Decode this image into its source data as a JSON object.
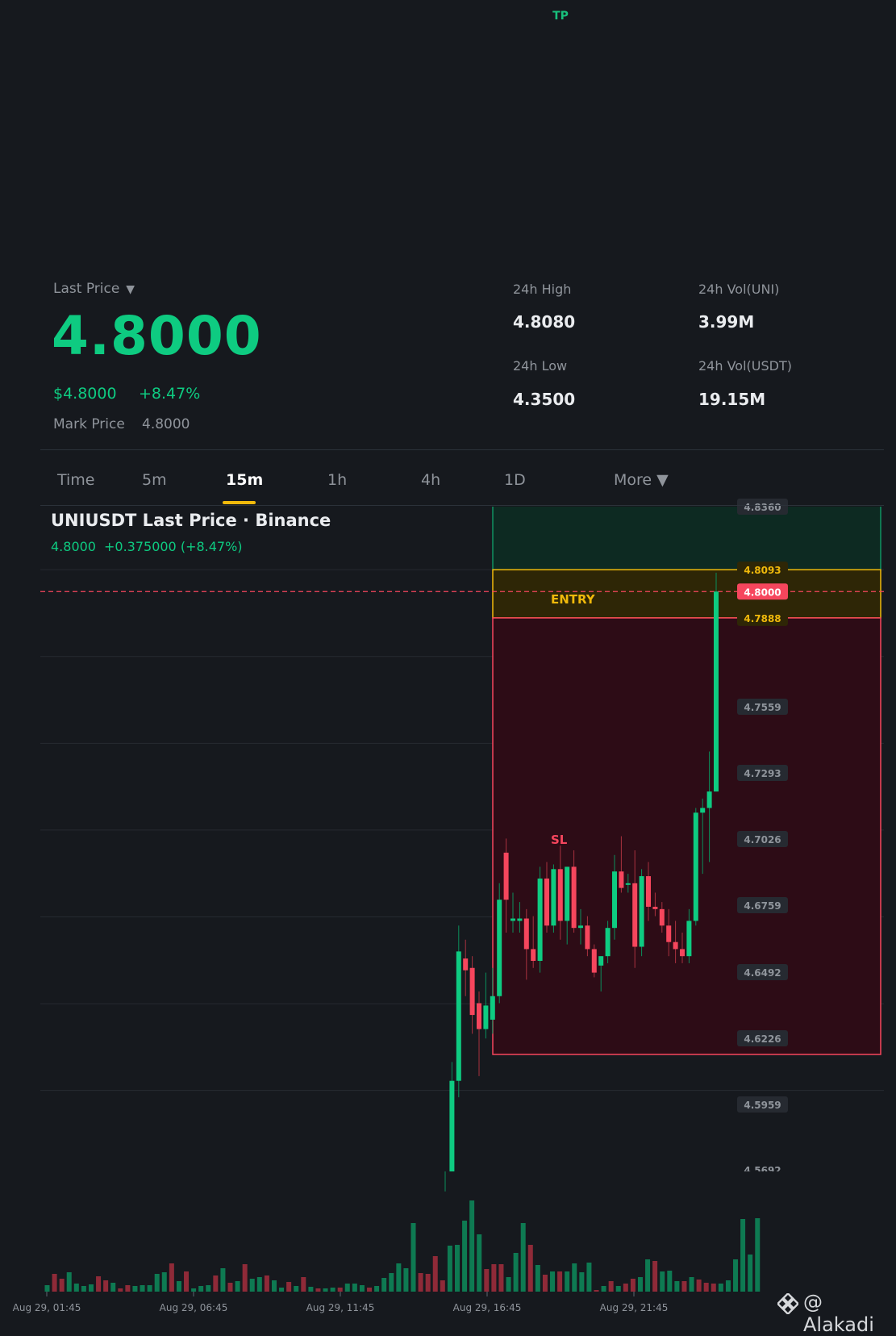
{
  "overlay": {
    "tp_label": "TP",
    "entry_label": "ENTRY",
    "sl_label": "SL"
  },
  "ticker": {
    "last_price_label": "Last Price",
    "last_price": "4.8000",
    "usd_price": "$4.8000",
    "change_pct": "+8.47%",
    "mark_price_label": "Mark Price",
    "mark_price": "4.8000",
    "stats": [
      {
        "label": "24h High",
        "value": "4.8080"
      },
      {
        "label": "24h Vol(UNI)",
        "value": "3.99M"
      },
      {
        "label": "24h Low",
        "value": "4.3500"
      },
      {
        "label": "24h Vol(USDT)",
        "value": "19.15M"
      }
    ]
  },
  "tabs": {
    "time": "Time",
    "m5": "5m",
    "m15": "15m",
    "h1": "1h",
    "h4": "4h",
    "d1": "1D",
    "more": "More"
  },
  "chart_header": {
    "title": "UNIUSDT Last Price · Binance",
    "price": "4.8000",
    "change": "+0.375000 (+8.47%)"
  },
  "watermark": "@ Alakadi",
  "colors": {
    "up": "#0ecb81",
    "down": "#f6465d",
    "accent": "#f0b90b",
    "background": "#16191e"
  },
  "chart_data": {
    "type": "candlestick",
    "y_ticks": [
      "4.8360",
      "4.5692",
      "4.5959",
      "4.6226",
      "4.6492",
      "4.6759",
      "4.7026",
      "4.7293",
      "4.7559"
    ],
    "levels": {
      "tp_top": "4.8093",
      "last": "4.8000",
      "entry_bottom": "4.7888"
    },
    "x_ticks": [
      "Aug 29, 01:45",
      "Aug 29, 06:45",
      "Aug 29, 11:45",
      "Aug 29, 16:45",
      "Aug 29, 21:45"
    ],
    "ylim": [
      4.5692,
      4.836
    ],
    "candles": [
      {
        "o": 4.53,
        "h": 4.545,
        "l": 4.52,
        "c": 4.543
      },
      {
        "o": 4.543,
        "h": 4.6,
        "l": 4.54,
        "c": 4.592
      },
      {
        "o": 4.592,
        "h": 4.658,
        "l": 4.585,
        "c": 4.647
      },
      {
        "o": 4.644,
        "h": 4.652,
        "l": 4.628,
        "c": 4.639
      },
      {
        "o": 4.64,
        "h": 4.645,
        "l": 4.612,
        "c": 4.62
      },
      {
        "o": 4.625,
        "h": 4.63,
        "l": 4.594,
        "c": 4.614
      },
      {
        "o": 4.614,
        "h": 4.638,
        "l": 4.61,
        "c": 4.624
      },
      {
        "o": 4.618,
        "h": 4.64,
        "l": 4.612,
        "c": 4.628
      },
      {
        "o": 4.628,
        "h": 4.676,
        "l": 4.625,
        "c": 4.669
      },
      {
        "o": 4.689,
        "h": 4.695,
        "l": 4.655,
        "c": 4.669
      },
      {
        "o": 4.66,
        "h": 4.672,
        "l": 4.655,
        "c": 4.661
      },
      {
        "o": 4.66,
        "h": 4.668,
        "l": 4.655,
        "c": 4.661
      },
      {
        "o": 4.661,
        "h": 4.665,
        "l": 4.635,
        "c": 4.648
      },
      {
        "o": 4.648,
        "h": 4.662,
        "l": 4.64,
        "c": 4.643
      },
      {
        "o": 4.643,
        "h": 4.683,
        "l": 4.638,
        "c": 4.678
      },
      {
        "o": 4.678,
        "h": 4.685,
        "l": 4.655,
        "c": 4.658
      },
      {
        "o": 4.658,
        "h": 4.684,
        "l": 4.655,
        "c": 4.682
      },
      {
        "o": 4.682,
        "h": 4.692,
        "l": 4.652,
        "c": 4.66
      },
      {
        "o": 4.66,
        "h": 4.683,
        "l": 4.65,
        "c": 4.683
      },
      {
        "o": 4.683,
        "h": 4.69,
        "l": 4.655,
        "c": 4.657
      },
      {
        "o": 4.657,
        "h": 4.665,
        "l": 4.65,
        "c": 4.658
      },
      {
        "o": 4.658,
        "h": 4.662,
        "l": 4.645,
        "c": 4.648
      },
      {
        "o": 4.648,
        "h": 4.65,
        "l": 4.636,
        "c": 4.638
      },
      {
        "o": 4.641,
        "h": 4.645,
        "l": 4.63,
        "c": 4.645
      },
      {
        "o": 4.645,
        "h": 4.66,
        "l": 4.642,
        "c": 4.657
      },
      {
        "o": 4.657,
        "h": 4.688,
        "l": 4.652,
        "c": 4.681
      },
      {
        "o": 4.681,
        "h": 4.696,
        "l": 4.672,
        "c": 4.674
      },
      {
        "o": 4.676,
        "h": 4.68,
        "l": 4.672,
        "c": 4.676
      },
      {
        "o": 4.676,
        "h": 4.69,
        "l": 4.64,
        "c": 4.649
      },
      {
        "o": 4.649,
        "h": 4.682,
        "l": 4.645,
        "c": 4.679
      },
      {
        "o": 4.679,
        "h": 4.685,
        "l": 4.66,
        "c": 4.666
      },
      {
        "o": 4.666,
        "h": 4.672,
        "l": 4.662,
        "c": 4.665
      },
      {
        "o": 4.665,
        "h": 4.668,
        "l": 4.655,
        "c": 4.658
      },
      {
        "o": 4.658,
        "h": 4.665,
        "l": 4.645,
        "c": 4.651
      },
      {
        "o": 4.651,
        "h": 4.66,
        "l": 4.642,
        "c": 4.648
      },
      {
        "o": 4.648,
        "h": 4.655,
        "l": 4.642,
        "c": 4.645
      },
      {
        "o": 4.645,
        "h": 4.665,
        "l": 4.642,
        "c": 4.66
      },
      {
        "o": 4.66,
        "h": 4.708,
        "l": 4.658,
        "c": 4.706
      },
      {
        "o": 4.706,
        "h": 4.712,
        "l": 4.68,
        "c": 4.708
      },
      {
        "o": 4.708,
        "h": 4.732,
        "l": 4.685,
        "c": 4.715
      },
      {
        "o": 4.715,
        "h": 4.808,
        "l": 4.715,
        "c": 4.8
      }
    ],
    "volume": [
      8,
      22,
      16,
      24,
      10,
      7,
      9,
      19,
      14,
      11,
      4,
      8,
      7,
      8,
      8,
      22,
      24,
      35,
      13,
      25,
      4,
      7,
      8,
      20,
      29,
      11,
      13,
      34,
      16,
      18,
      20,
      14,
      5,
      12,
      7,
      18,
      6,
      4,
      4,
      5,
      5,
      10,
      10,
      8,
      5,
      7,
      17,
      23,
      35,
      29,
      85,
      23,
      22,
      44,
      14,
      57,
      58,
      88,
      113,
      71,
      28,
      34,
      34,
      18,
      48,
      85,
      58,
      33,
      21,
      25,
      25,
      25,
      35,
      24,
      36,
      2,
      7,
      13,
      7,
      10,
      16,
      18,
      40,
      38,
      25,
      26,
      13,
      13,
      18,
      15,
      11,
      10,
      10,
      14,
      40,
      90,
      46,
      91
    ],
    "volume_dirs": [
      1,
      0,
      0,
      1,
      1,
      1,
      1,
      0,
      0,
      1,
      0,
      0,
      1,
      1,
      1,
      1,
      1,
      0,
      1,
      0,
      1,
      1,
      1,
      0,
      1,
      0,
      1,
      0,
      1,
      1,
      0,
      1,
      1,
      0,
      1,
      0,
      1,
      0,
      1,
      1,
      0,
      1,
      1,
      1,
      0,
      1,
      1,
      1,
      1,
      1,
      1,
      0,
      0,
      0,
      0,
      1,
      1,
      1,
      1,
      1,
      0,
      0,
      0,
      1,
      1,
      1,
      0,
      1,
      0,
      1,
      0,
      1,
      1,
      1,
      1,
      0,
      1,
      0,
      1,
      0,
      0,
      1,
      1,
      0,
      1,
      1,
      1,
      0,
      1,
      0,
      0,
      0,
      1,
      1,
      1,
      1,
      1,
      1
    ]
  }
}
